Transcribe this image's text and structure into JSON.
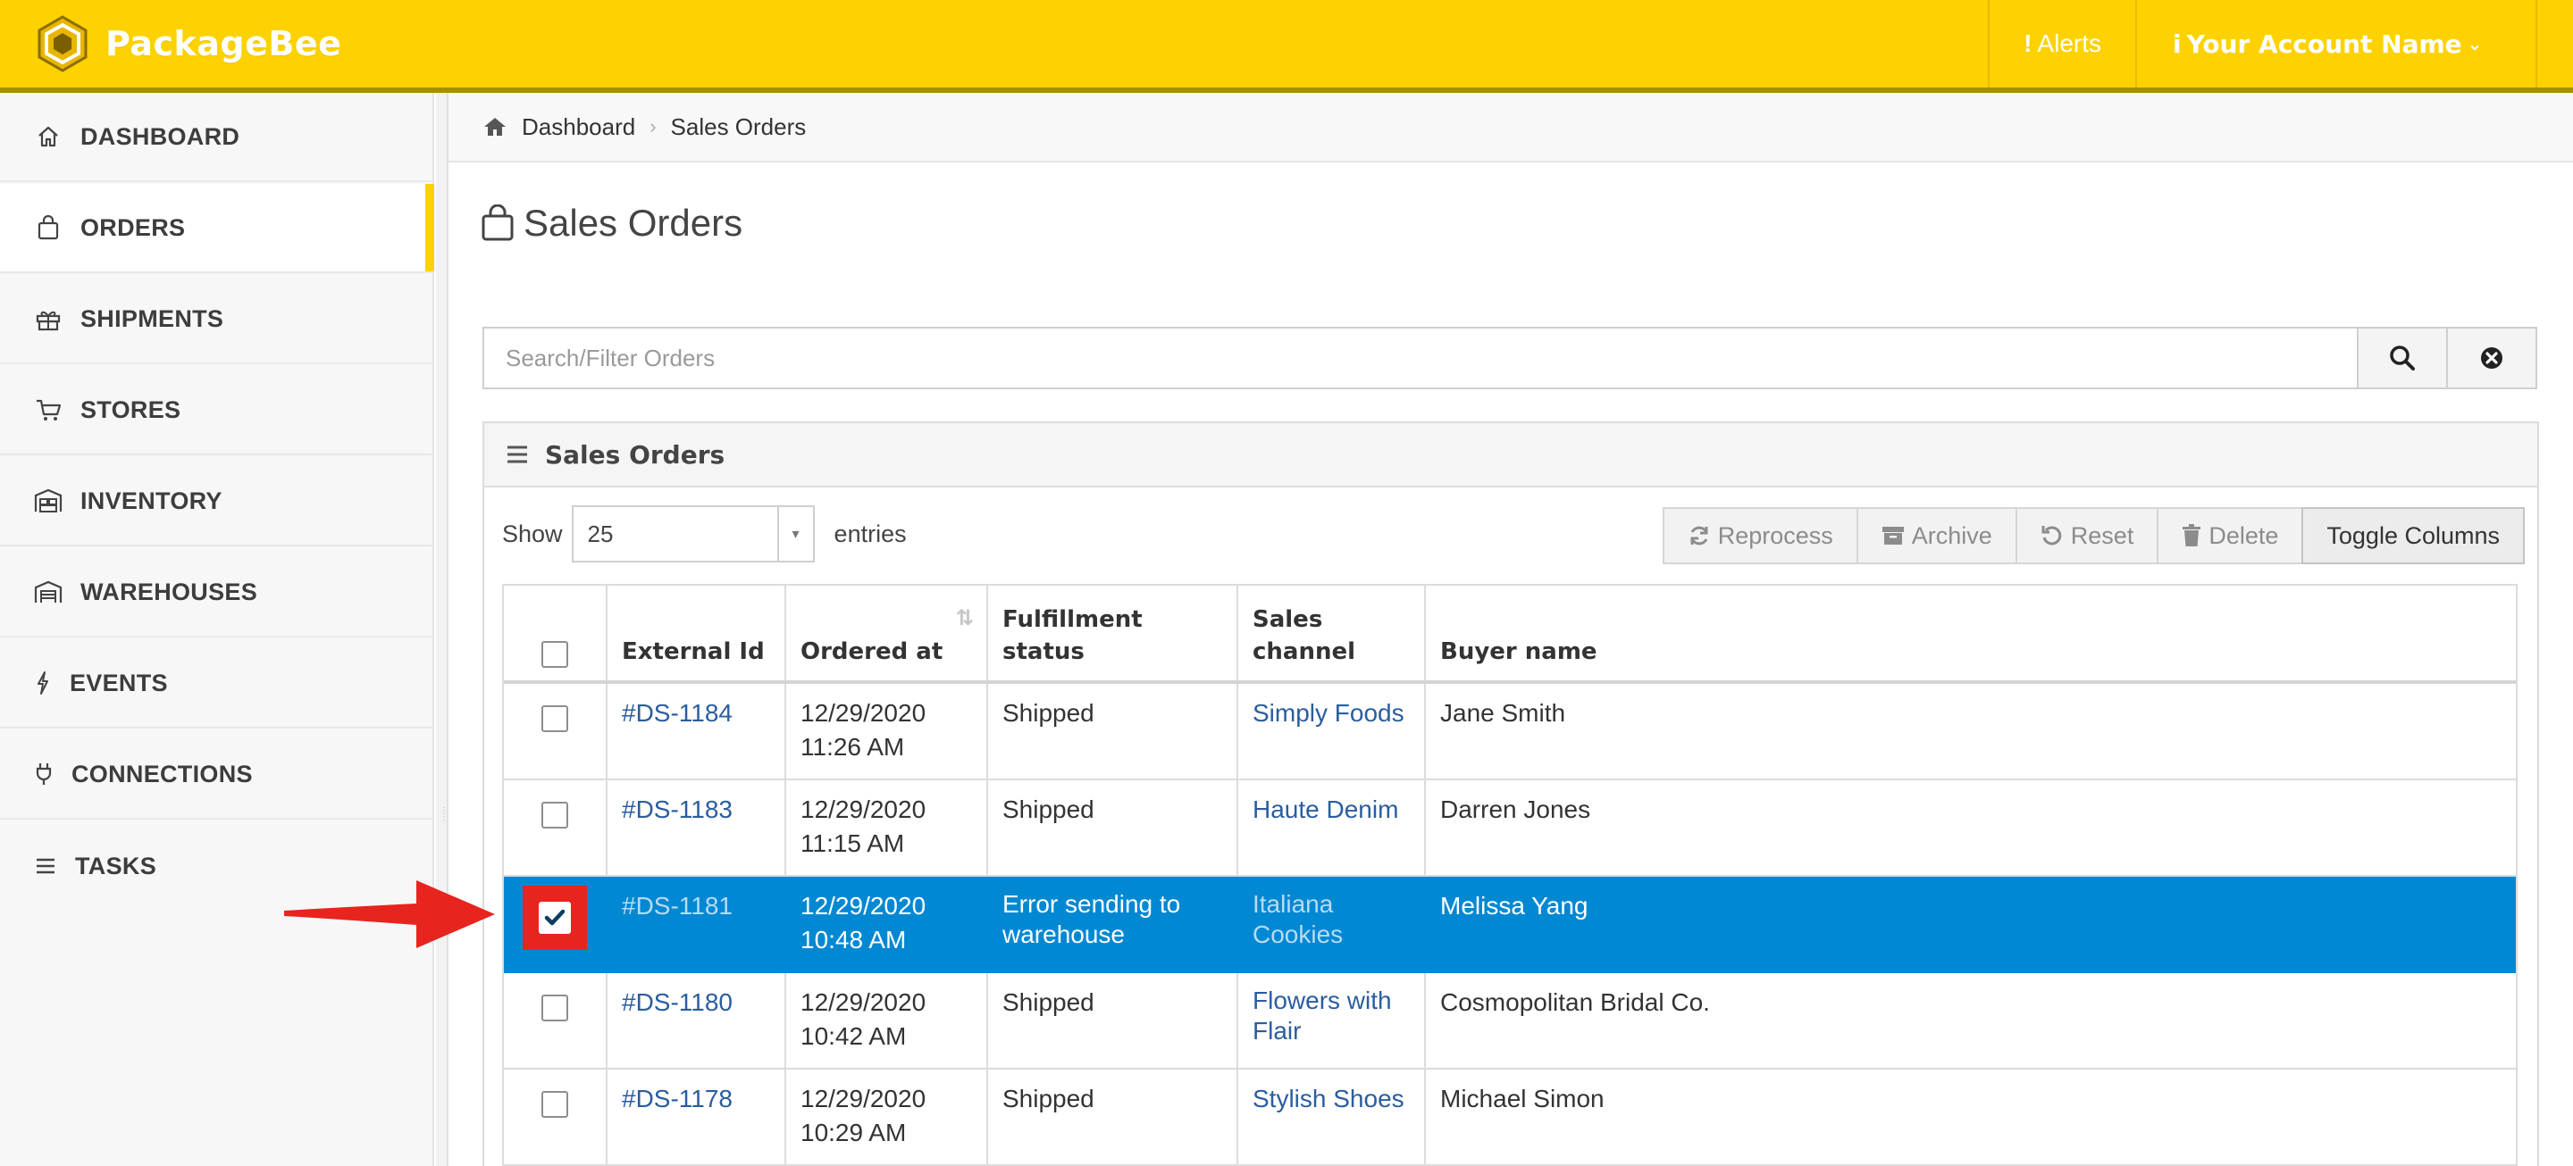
{
  "app": {
    "brand": "PackageBee"
  },
  "topbar": {
    "alerts_label": "Alerts",
    "account_label": "Your Account Name"
  },
  "sidebar": {
    "items": [
      {
        "label": "DASHBOARD",
        "icon": "home-icon",
        "active": false
      },
      {
        "label": "ORDERS",
        "icon": "shopping-bag-icon",
        "active": true
      },
      {
        "label": "SHIPMENTS",
        "icon": "gift-icon",
        "active": false
      },
      {
        "label": "STORES",
        "icon": "cart-icon",
        "active": false
      },
      {
        "label": "INVENTORY",
        "icon": "warehouse-shelves-icon",
        "active": false
      },
      {
        "label": "WAREHOUSES",
        "icon": "warehouse-icon",
        "active": false
      },
      {
        "label": "EVENTS",
        "icon": "bolt-icon",
        "active": false
      },
      {
        "label": "CONNECTIONS",
        "icon": "plug-icon",
        "active": false
      },
      {
        "label": "TASKS",
        "icon": "list-icon",
        "active": false
      }
    ]
  },
  "breadcrumb": {
    "home": "Dashboard",
    "current": "Sales Orders"
  },
  "page": {
    "title": "Sales Orders"
  },
  "search": {
    "placeholder": "Search/Filter Orders",
    "value": ""
  },
  "panel": {
    "title": "Sales Orders",
    "show_label": "Show",
    "entries_label": "entries",
    "page_size": "25",
    "actions": {
      "reprocess": "Reprocess",
      "archive": "Archive",
      "reset": "Reset",
      "delete": "Delete",
      "toggle_columns": "Toggle Columns"
    }
  },
  "table": {
    "headers": {
      "external_id": "External Id",
      "ordered_at": "Ordered at",
      "fulfillment_status": "Fulfillment status",
      "sales_channel": "Sales channel",
      "buyer_name": "Buyer name"
    },
    "rows": [
      {
        "external_id": "#DS-1184",
        "ordered_date": "12/29/2020",
        "ordered_time": "11:26 AM",
        "status": "Shipped",
        "channel": "Simply Foods",
        "buyer": "Jane Smith",
        "selected": false
      },
      {
        "external_id": "#DS-1183",
        "ordered_date": "12/29/2020",
        "ordered_time": "11:15 AM",
        "status": "Shipped",
        "channel": "Haute Denim",
        "buyer": "Darren Jones",
        "selected": false
      },
      {
        "external_id": "#DS-1181",
        "ordered_date": "12/29/2020",
        "ordered_time": "10:48 AM",
        "status": "Error sending to warehouse",
        "channel": "Italiana Cookies",
        "buyer": "Melissa Yang",
        "selected": true
      },
      {
        "external_id": "#DS-1180",
        "ordered_date": "12/29/2020",
        "ordered_time": "10:42 AM",
        "status": "Shipped",
        "channel": "Flowers with Flair",
        "buyer": "Cosmopolitan Bridal Co.",
        "selected": false
      },
      {
        "external_id": "#DS-1178",
        "ordered_date": "12/29/2020",
        "ordered_time": "10:29 AM",
        "status": "Shipped",
        "channel": "Stylish Shoes",
        "buyer": "Michael Simon",
        "selected": false
      }
    ]
  },
  "colors": {
    "topbar": "#fdd200",
    "selected_row": "#0188d3",
    "annotation": "#e8241f",
    "link": "#2b5d9f"
  }
}
